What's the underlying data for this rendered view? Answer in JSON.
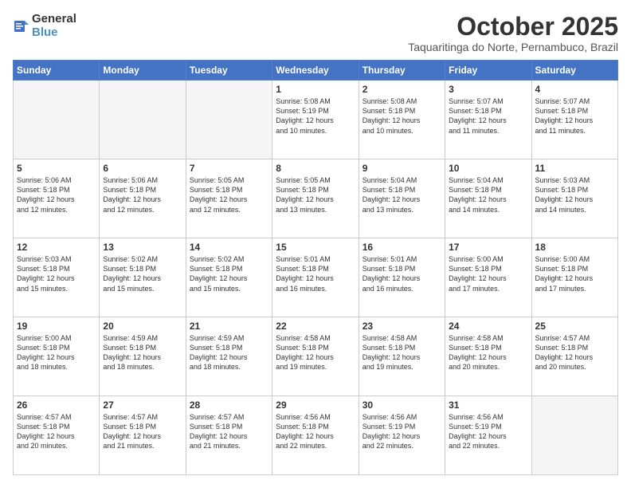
{
  "header": {
    "logo": {
      "line1": "General",
      "line2": "Blue"
    },
    "title": "October 2025",
    "location": "Taquaritinga do Norte, Pernambuco, Brazil"
  },
  "weekdays": [
    "Sunday",
    "Monday",
    "Tuesday",
    "Wednesday",
    "Thursday",
    "Friday",
    "Saturday"
  ],
  "weeks": [
    [
      {
        "day": "",
        "info": ""
      },
      {
        "day": "",
        "info": ""
      },
      {
        "day": "",
        "info": ""
      },
      {
        "day": "1",
        "info": "Sunrise: 5:08 AM\nSunset: 5:19 PM\nDaylight: 12 hours\nand 10 minutes."
      },
      {
        "day": "2",
        "info": "Sunrise: 5:08 AM\nSunset: 5:18 PM\nDaylight: 12 hours\nand 10 minutes."
      },
      {
        "day": "3",
        "info": "Sunrise: 5:07 AM\nSunset: 5:18 PM\nDaylight: 12 hours\nand 11 minutes."
      },
      {
        "day": "4",
        "info": "Sunrise: 5:07 AM\nSunset: 5:18 PM\nDaylight: 12 hours\nand 11 minutes."
      }
    ],
    [
      {
        "day": "5",
        "info": "Sunrise: 5:06 AM\nSunset: 5:18 PM\nDaylight: 12 hours\nand 12 minutes."
      },
      {
        "day": "6",
        "info": "Sunrise: 5:06 AM\nSunset: 5:18 PM\nDaylight: 12 hours\nand 12 minutes."
      },
      {
        "day": "7",
        "info": "Sunrise: 5:05 AM\nSunset: 5:18 PM\nDaylight: 12 hours\nand 12 minutes."
      },
      {
        "day": "8",
        "info": "Sunrise: 5:05 AM\nSunset: 5:18 PM\nDaylight: 12 hours\nand 13 minutes."
      },
      {
        "day": "9",
        "info": "Sunrise: 5:04 AM\nSunset: 5:18 PM\nDaylight: 12 hours\nand 13 minutes."
      },
      {
        "day": "10",
        "info": "Sunrise: 5:04 AM\nSunset: 5:18 PM\nDaylight: 12 hours\nand 14 minutes."
      },
      {
        "day": "11",
        "info": "Sunrise: 5:03 AM\nSunset: 5:18 PM\nDaylight: 12 hours\nand 14 minutes."
      }
    ],
    [
      {
        "day": "12",
        "info": "Sunrise: 5:03 AM\nSunset: 5:18 PM\nDaylight: 12 hours\nand 15 minutes."
      },
      {
        "day": "13",
        "info": "Sunrise: 5:02 AM\nSunset: 5:18 PM\nDaylight: 12 hours\nand 15 minutes."
      },
      {
        "day": "14",
        "info": "Sunrise: 5:02 AM\nSunset: 5:18 PM\nDaylight: 12 hours\nand 15 minutes."
      },
      {
        "day": "15",
        "info": "Sunrise: 5:01 AM\nSunset: 5:18 PM\nDaylight: 12 hours\nand 16 minutes."
      },
      {
        "day": "16",
        "info": "Sunrise: 5:01 AM\nSunset: 5:18 PM\nDaylight: 12 hours\nand 16 minutes."
      },
      {
        "day": "17",
        "info": "Sunrise: 5:00 AM\nSunset: 5:18 PM\nDaylight: 12 hours\nand 17 minutes."
      },
      {
        "day": "18",
        "info": "Sunrise: 5:00 AM\nSunset: 5:18 PM\nDaylight: 12 hours\nand 17 minutes."
      }
    ],
    [
      {
        "day": "19",
        "info": "Sunrise: 5:00 AM\nSunset: 5:18 PM\nDaylight: 12 hours\nand 18 minutes."
      },
      {
        "day": "20",
        "info": "Sunrise: 4:59 AM\nSunset: 5:18 PM\nDaylight: 12 hours\nand 18 minutes."
      },
      {
        "day": "21",
        "info": "Sunrise: 4:59 AM\nSunset: 5:18 PM\nDaylight: 12 hours\nand 18 minutes."
      },
      {
        "day": "22",
        "info": "Sunrise: 4:58 AM\nSunset: 5:18 PM\nDaylight: 12 hours\nand 19 minutes."
      },
      {
        "day": "23",
        "info": "Sunrise: 4:58 AM\nSunset: 5:18 PM\nDaylight: 12 hours\nand 19 minutes."
      },
      {
        "day": "24",
        "info": "Sunrise: 4:58 AM\nSunset: 5:18 PM\nDaylight: 12 hours\nand 20 minutes."
      },
      {
        "day": "25",
        "info": "Sunrise: 4:57 AM\nSunset: 5:18 PM\nDaylight: 12 hours\nand 20 minutes."
      }
    ],
    [
      {
        "day": "26",
        "info": "Sunrise: 4:57 AM\nSunset: 5:18 PM\nDaylight: 12 hours\nand 20 minutes."
      },
      {
        "day": "27",
        "info": "Sunrise: 4:57 AM\nSunset: 5:18 PM\nDaylight: 12 hours\nand 21 minutes."
      },
      {
        "day": "28",
        "info": "Sunrise: 4:57 AM\nSunset: 5:18 PM\nDaylight: 12 hours\nand 21 minutes."
      },
      {
        "day": "29",
        "info": "Sunrise: 4:56 AM\nSunset: 5:18 PM\nDaylight: 12 hours\nand 22 minutes."
      },
      {
        "day": "30",
        "info": "Sunrise: 4:56 AM\nSunset: 5:19 PM\nDaylight: 12 hours\nand 22 minutes."
      },
      {
        "day": "31",
        "info": "Sunrise: 4:56 AM\nSunset: 5:19 PM\nDaylight: 12 hours\nand 22 minutes."
      },
      {
        "day": "",
        "info": ""
      }
    ]
  ]
}
